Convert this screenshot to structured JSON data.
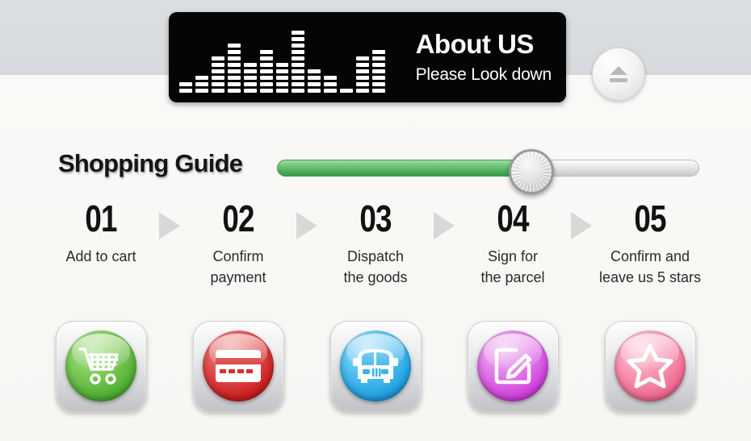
{
  "header": {
    "title": "About US",
    "subtitle": "Please Look down",
    "equalizer_name": "audio-equalizer-graphic",
    "equalizer_levels": [
      2,
      3,
      6,
      8,
      5,
      7,
      5,
      10,
      4,
      3,
      1,
      6,
      7
    ],
    "eject_button_name": "eject-button"
  },
  "guide": {
    "title": "Shopping Guide",
    "slider": {
      "value_percent": 60,
      "fill_color": "#49ab58",
      "track_color": "#e7e7e7"
    }
  },
  "steps": [
    {
      "number": "01",
      "label": "Add to cart",
      "icon": "shopping-cart-icon",
      "color": "#4fae33"
    },
    {
      "number": "02",
      "label": "Confirm\npayment",
      "icon": "credit-card-icon",
      "color": "#cc1f1f"
    },
    {
      "number": "03",
      "label": "Dispatch\nthe goods",
      "icon": "delivery-truck-icon",
      "color": "#1fa0e0"
    },
    {
      "number": "04",
      "label": "Sign for\nthe parcel",
      "icon": "sign-pencil-icon",
      "color": "#d040dd"
    },
    {
      "number": "05",
      "label": "Confirm and\nleave us 5 stars",
      "icon": "star-icon",
      "color": "#ef6a90"
    }
  ],
  "arrow_icon_name": "chevron-right-arrow-icon",
  "background": {
    "top_band_color": "#d9dcdf",
    "body_color": "#f8f6f3"
  }
}
